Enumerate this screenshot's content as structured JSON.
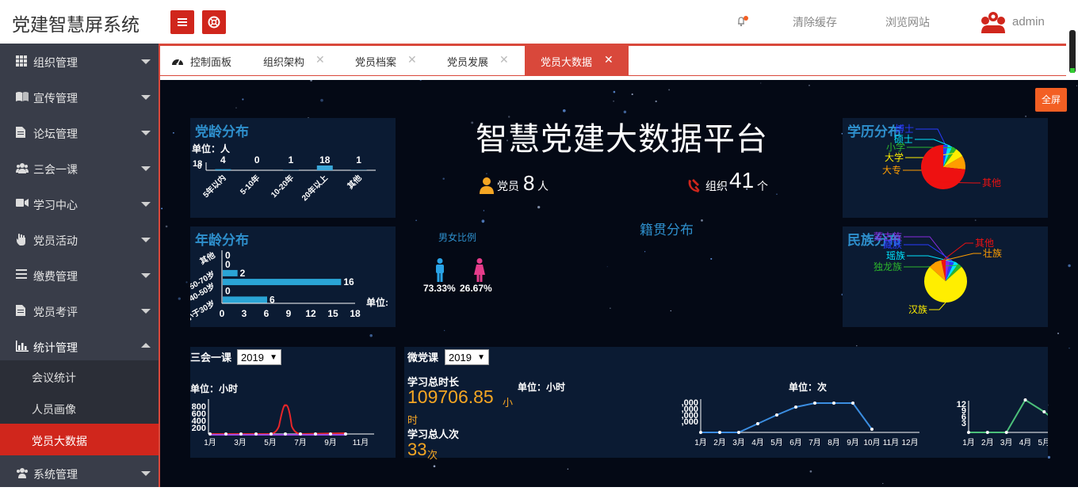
{
  "app": {
    "title": "党建智慧屏系统"
  },
  "header": {
    "menu_icon": "hamburger-icon",
    "lifebuoy_icon": "lifebuoy-icon",
    "bell_icon": "bell-icon",
    "clear_cache": "清除缓存",
    "browse_site": "浏览网站",
    "user": "admin",
    "avatar_icon": "party-people-icon"
  },
  "sidebar": {
    "items": [
      {
        "label": "组织管理",
        "icon": "grid-icon"
      },
      {
        "label": "宣传管理",
        "icon": "book-icon"
      },
      {
        "label": "论坛管理",
        "icon": "file-icon"
      },
      {
        "label": "三会一课",
        "icon": "users-icon"
      },
      {
        "label": "学习中心",
        "icon": "video-icon"
      },
      {
        "label": "党员活动",
        "icon": "hand-icon"
      },
      {
        "label": "缴费管理",
        "icon": "list-icon"
      },
      {
        "label": "党员考评",
        "icon": "file-icon"
      },
      {
        "label": "统计管理",
        "icon": "bar-chart-icon"
      }
    ],
    "sub_items": [
      "会议统计",
      "人员画像",
      "党员大数据"
    ],
    "bottom_item": {
      "label": "系统管理",
      "icon": "users-icon"
    }
  },
  "tabs": [
    {
      "label": "控制面板"
    },
    {
      "label": "组织架构"
    },
    {
      "label": "党员档案"
    },
    {
      "label": "党员发展"
    },
    {
      "label": "党员大数据"
    }
  ],
  "screen": {
    "fullscreen": "全屏",
    "title": "智慧党建大数据平台",
    "members_label": "党员",
    "members_count": "8",
    "members_unit": "人",
    "org_label": "组织",
    "org_count": "41",
    "org_unit": "个",
    "gender_title": "男女比例",
    "male_pct": "73.33%",
    "female_pct": "26.67%",
    "native_title": "籍贯分布",
    "party_age": {
      "title": "党龄分布",
      "unit": "单位：人",
      "categories": [
        "5年以内",
        "5-10年",
        "10-20年",
        "20年以上",
        "其他"
      ],
      "values": [
        4,
        0,
        1,
        18,
        1
      ],
      "ymark_a": "18",
      "ymark_b": "0"
    },
    "age": {
      "title": "年龄分布",
      "unit": "单位:",
      "categories": [
        "小于30岁",
        "",
        "30-50岁",
        "50-70岁",
        "",
        "其他"
      ],
      "cat_labels": [
        "小于30岁",
        "40-50岁",
        "50-70岁",
        "其他"
      ],
      "values": [
        6,
        0,
        16,
        2,
        0,
        0
      ],
      "xticks": [
        "0",
        "3",
        "6",
        "9",
        "12",
        "15",
        "18"
      ]
    },
    "education": {
      "title": "学历分布",
      "labels": [
        "博士",
        "硕士",
        "小学",
        "大学",
        "大专",
        "其他"
      ],
      "values": [
        1,
        1,
        1,
        2,
        3,
        22
      ],
      "colors": [
        "#2a3bff",
        "#00e5ff",
        "#2cb52c",
        "#ffee00",
        "#ff9d00",
        "#ee1111"
      ]
    },
    "ethnic": {
      "title": "民族分布",
      "labels": [
        "蒙古族",
        "藏族",
        "瑶族",
        "独龙族",
        "汉族",
        "壮族",
        "其他"
      ],
      "values": [
        1,
        1,
        1,
        1,
        22,
        3,
        1
      ],
      "colors": [
        "#8a2be2",
        "#2a3bff",
        "#00e5ff",
        "#2cb52c",
        "#ffee00",
        "#ff9d00",
        "#ee1111"
      ]
    },
    "meeting": {
      "title": "三会一课",
      "year": "2019",
      "unit": "单位：小时",
      "yticks": [
        "800",
        "600",
        "400",
        "200"
      ],
      "xticks": [
        "1月",
        "3月",
        "5月",
        "7月",
        "9月",
        "11月"
      ]
    },
    "micro": {
      "title": "微党课",
      "year": "2019",
      "total_time_label": "学习总时长",
      "total_time": "109706.85",
      "time_unit_a": "小",
      "time_unit_b": "时",
      "total_people_label": "学习总人次",
      "total_people": "33",
      "people_unit": "次",
      "hours_unit": "单位：小时",
      "count_unit": "单位：次",
      "months": [
        "1月",
        "2月",
        "3月",
        "4月",
        "5月",
        "6月",
        "7月",
        "8月",
        "9月",
        "10月",
        "11月",
        "12月"
      ],
      "yticks_hours": [
        ",000",
        ",000",
        ",000",
        ",000"
      ],
      "yticks_count": [
        "12",
        "9",
        "6",
        "3"
      ]
    }
  }
}
